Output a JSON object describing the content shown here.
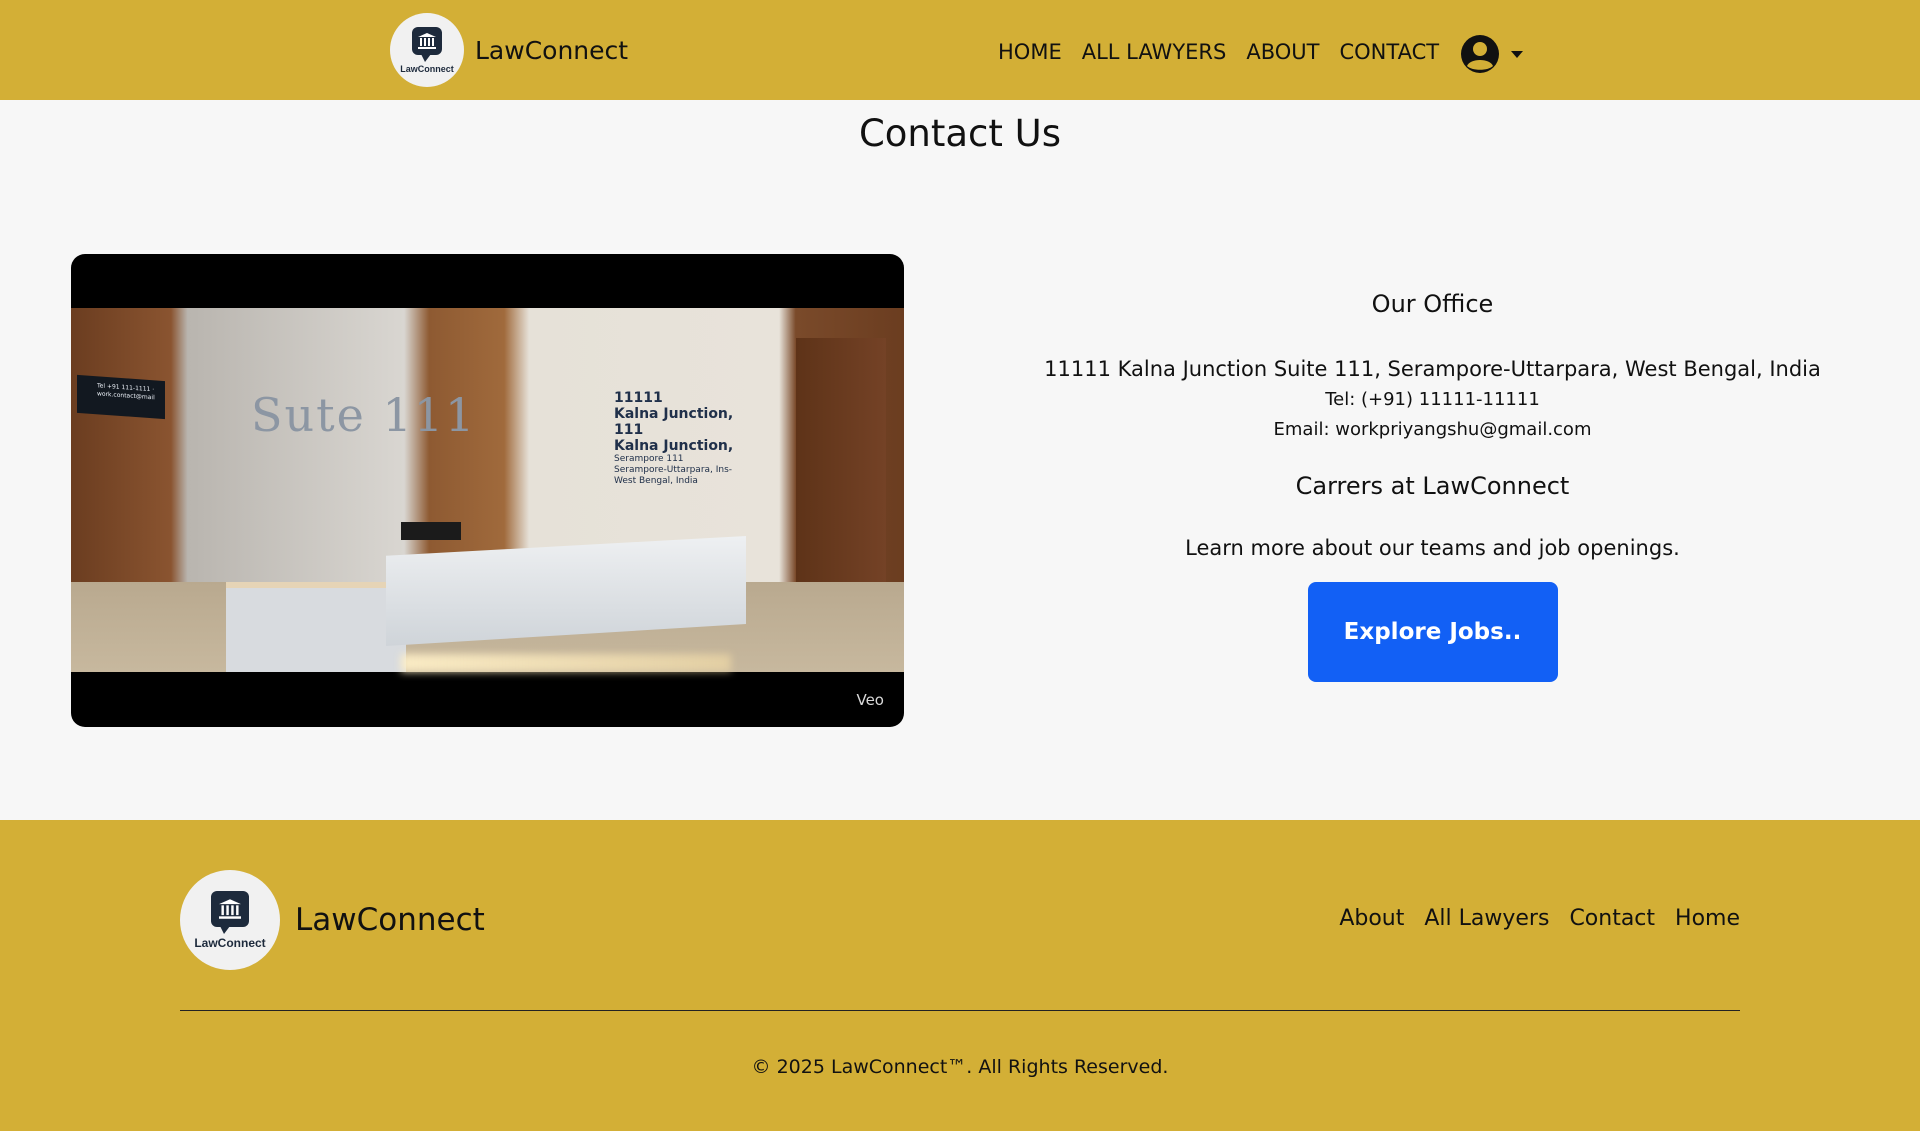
{
  "header": {
    "brand_name": "LawConnect",
    "logo_text": "LawConnect",
    "nav": [
      {
        "label": "HOME"
      },
      {
        "label": "ALL LAWYERS"
      },
      {
        "label": "ABOUT"
      },
      {
        "label": "CONTACT"
      }
    ],
    "profile_icon": "user-circle-icon",
    "caret_icon": "caret-down-icon"
  },
  "page": {
    "title": "Contact Us"
  },
  "video": {
    "watermark": "Veo",
    "scene_sign": "Sute 111",
    "scene_address_lines": [
      "11111",
      "Kalna Junction, 111",
      "Kalna Junction,",
      "Serampore 111",
      "Serampore-Uttarpara, Ins-",
      "West Bengal, India"
    ],
    "scene_plaque": "Tel +91 111-1111 · work.contact@mail"
  },
  "office": {
    "heading": "Our Office",
    "address": "11111 Kalna Junction Suite 111, Serampore-Uttarpara, West Bengal, India",
    "tel": "Tel: (+91) 11111-11111",
    "email": "Email: workpriyangshu@gmail.com"
  },
  "careers": {
    "heading": "Carrers at LawConnect",
    "text": "Learn more about our teams and job openings.",
    "button_label": "Explore Jobs.."
  },
  "footer": {
    "brand_name": "LawConnect",
    "logo_text": "LawConnect",
    "links": [
      {
        "label": "About"
      },
      {
        "label": "All Lawyers"
      },
      {
        "label": "Contact"
      },
      {
        "label": "Home"
      }
    ],
    "copyright": "© 2025 LawConnect™. All Rights Reserved."
  },
  "colors": {
    "header_bg": "#d3af36",
    "footer_bg": "#d3af36",
    "button_bg": "#1260f5",
    "page_bg": "#f7f7f7"
  }
}
